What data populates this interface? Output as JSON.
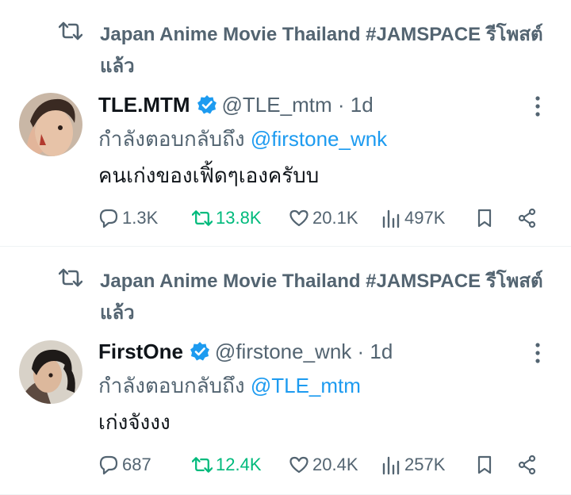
{
  "tweets": [
    {
      "retweeted_by": "Japan Anime Movie Thailand #JAMSPACE รีโพสต์แล้ว",
      "display_name": "TLE.MTM",
      "handle": "@TLE_mtm",
      "dot": "·",
      "time": "1d",
      "reply_prefix": "กำลังตอบกลับถึง",
      "reply_to": "@firstone_wnk",
      "text": "คนเก่งของเฟิ้ดๆเองครับบ",
      "replies": "1.3K",
      "reposts": "13.8K",
      "likes": "20.1K",
      "views": "497K",
      "avatar_colors": {
        "bg": "#c9b7a6",
        "hair": "#3a2a22",
        "skin": "#e7c3a8",
        "accent": "#b23a2e"
      }
    },
    {
      "retweeted_by": "Japan Anime Movie Thailand #JAMSPACE รีโพสต์แล้ว",
      "display_name": "FirstOne",
      "handle": "@firstone_wnk",
      "dot": "·",
      "time": "1d",
      "reply_prefix": "กำลังตอบกลับถึง",
      "reply_to": "@TLE_mtm",
      "text": "เก่งจังงง",
      "replies": "687",
      "reposts": "12.4K",
      "likes": "20.4K",
      "views": "257K",
      "avatar_colors": {
        "bg": "#d8d2c8",
        "hair": "#1e1a18",
        "skin": "#dcb89c",
        "accent": "#5c4a40"
      }
    }
  ],
  "colors": {
    "verified": "#1d9bf0",
    "retweet_active": "#00ba7c",
    "muted": "#536471",
    "link": "#1d9bf0"
  },
  "icons": [
    "retweet-icon",
    "verified-badge-icon",
    "more-icon",
    "reply-icon",
    "repost-icon",
    "like-icon",
    "views-icon",
    "bookmark-icon",
    "share-icon"
  ]
}
